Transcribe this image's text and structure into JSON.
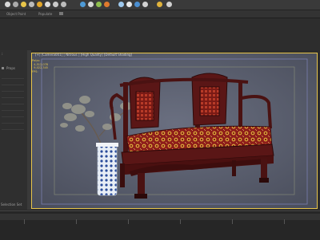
{
  "ribbon": {
    "tab1": "Object Paint",
    "tab2": "Populate"
  },
  "left_panel": {
    "header": "Props",
    "selection_set": "Selection Set"
  },
  "viewport": {
    "title": "[+] [Camera001] [ Nitrous ] [High Quality] [Default Shading]",
    "stats": "Polys:\n  4,512,078\n  9,022,345\nFPS:"
  },
  "colors": {
    "accent": "#e8c54a",
    "viewport_bg": "#5b6070",
    "sofa_wood": "#5a1616",
    "cushion": "#8e1e1a"
  }
}
